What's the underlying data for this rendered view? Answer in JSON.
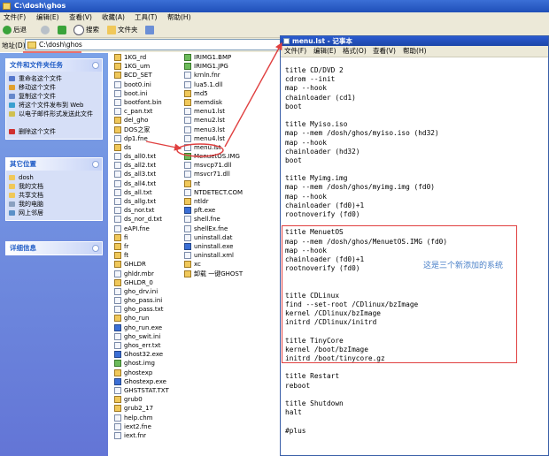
{
  "window": {
    "title": "C:\\dosh\\ghos"
  },
  "menu": [
    "文件(F)",
    "编辑(E)",
    "查看(V)",
    "收藏(A)",
    "工具(T)",
    "帮助(H)"
  ],
  "toolbar": {
    "back": "后退",
    "search": "搜索",
    "folders": "文件夹"
  },
  "address": {
    "label": "地址(D)",
    "value": "C:\\dosh\\ghos"
  },
  "tasks": {
    "title": "文件和文件夹任务",
    "items": [
      "重命名这个文件",
      "移动这个文件",
      "复制这个文件",
      "将这个文件发布到 Web",
      "以电子邮件形式发送此文件",
      "删除这个文件"
    ]
  },
  "places": {
    "title": "其它位置",
    "items": [
      "dosh",
      "我的文档",
      "共享文档",
      "我的电脑",
      "网上邻居"
    ]
  },
  "details": {
    "title": "详细信息"
  },
  "files": {
    "col1": [
      "1KG_rd",
      "1KG_um",
      "BCD_SET",
      "boot0.ini",
      "boot.ini",
      "bootfont.bin",
      "c_pan.txt",
      "del_gho",
      "DOS之家",
      "dp1.fne",
      "ds",
      "ds_all0.txt",
      "ds_all2.txt",
      "ds_all3.txt",
      "ds_all4.txt",
      "ds_all.txt",
      "ds_allg.txt",
      "ds_nor.txt",
      "ds_nor_d.txt",
      "eAPI.fne",
      "fi",
      "fr",
      "ft",
      "GHLDR",
      "ghldr.mbr",
      "GHLDR_0",
      "gho_drv.ini",
      "gho_pass.ini",
      "gho_pass.txt",
      "gho_run",
      "gho_run.exe",
      "gho_swit.ini",
      "ghos_err.txt",
      "Ghost32.exe",
      "ghost.img",
      "ghostexp",
      "Ghostexp.exe",
      "GHSTSTAT.TXT",
      "grub0",
      "grub2_17",
      "help.chm",
      "iext2.fne",
      "iext.fnr"
    ],
    "col2": [
      "IRIMG1.BMP",
      "IRIMG1.JPG",
      "krnln.fnr",
      "lua5.1.dll",
      "md5",
      "memdisk",
      "menu1.lst",
      "menu2.lst",
      "menu3.lst",
      "menu4.lst",
      "menu.lst",
      "MenuetOS.IMG",
      "msvcp71.dll",
      "msvcr71.dll",
      "nt",
      "NTDETECT.COM",
      "ntldr",
      "pft.exe",
      "shell.fne",
      "shellEx.fne",
      "uninstall.dat",
      "uninstall.exe",
      "uninstall.xml",
      "xc",
      "卸载 一键GHOST"
    ]
  },
  "notepad": {
    "title": "menu.lst - 记事本",
    "menu": [
      "文件(F)",
      "编辑(E)",
      "格式(O)",
      "查看(V)",
      "帮助(H)"
    ],
    "lines": [
      "title CD/DVD 2",
      "cdrom --init",
      "map --hook",
      "chainloader (cd1)",
      "boot",
      "",
      "title Myiso.iso",
      "map --mem /dosh/ghos/myiso.iso (hd32)",
      "map --hook",
      "chainloader (hd32)",
      "boot",
      "",
      "title Myimg.img",
      "map --mem /dosh/ghos/myimg.img (fd0)",
      "map --hook",
      "chainloader (fd0)+1",
      "rootnoverify (fd0)",
      "",
      "title MenuetOS",
      "map --mem /dosh/ghos/MenuetOS.IMG (fd0)",
      "map --hook",
      "chainloader (fd0)+1",
      "rootnoverify (fd0)",
      "",
      "",
      "title CDLinux",
      "find --set-root /CDlinux/bzImage",
      "kernel /CDlinux/bzImage",
      "initrd /CDlinux/initrd",
      "",
      "title TinyCore",
      "kernel /boot/bzImage",
      "initrd /boot/tinycore.gz",
      "",
      "title Restart",
      "reboot",
      "",
      "title Shutdown",
      "halt",
      "",
      "#plus"
    ]
  },
  "annotation": "这是三个新添加的系统",
  "colors": {
    "title_blue": "#1f4fb8",
    "highlight_red": "#e04040",
    "annotation_blue": "#4a80c8"
  }
}
